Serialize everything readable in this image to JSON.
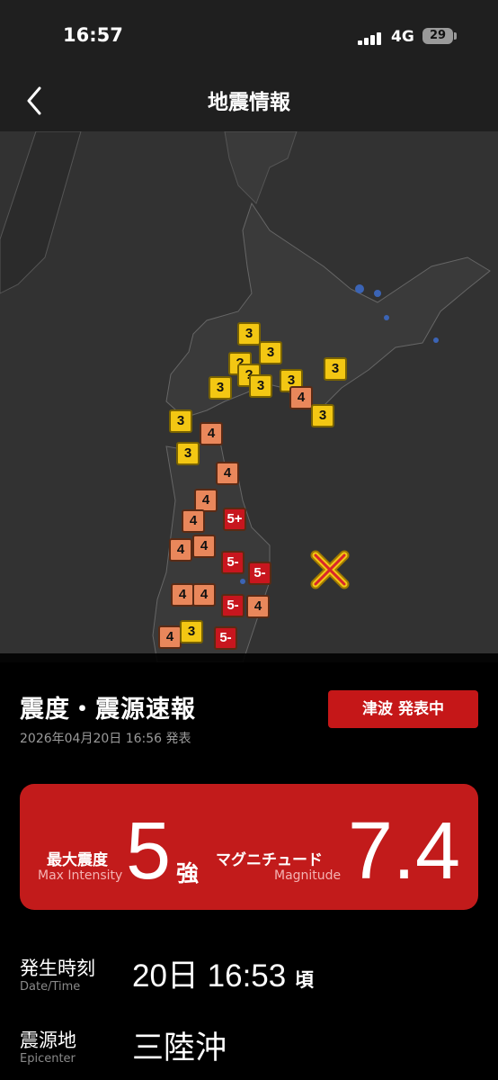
{
  "status_bar": {
    "time": "16:57",
    "network": "4G",
    "battery": "29"
  },
  "nav": {
    "title": "地震情報"
  },
  "map": {
    "markers": [
      {
        "label": "3",
        "level": "3"
      },
      {
        "label": "3",
        "level": "3"
      },
      {
        "label": "?",
        "level": "3"
      },
      {
        "label": "?",
        "level": "3"
      },
      {
        "label": "3",
        "level": "3"
      },
      {
        "label": "3",
        "level": "3"
      },
      {
        "label": "3",
        "level": "3"
      },
      {
        "label": "3",
        "level": "3"
      },
      {
        "label": "4",
        "level": "4"
      },
      {
        "label": "3",
        "level": "3"
      },
      {
        "label": "3",
        "level": "3"
      },
      {
        "label": "4",
        "level": "4"
      },
      {
        "label": "3",
        "level": "3"
      },
      {
        "label": "4",
        "level": "4"
      },
      {
        "label": "4",
        "level": "4"
      },
      {
        "label": "4",
        "level": "4"
      },
      {
        "label": "5+",
        "level": "5"
      },
      {
        "label": "4",
        "level": "4"
      },
      {
        "label": "4",
        "level": "4"
      },
      {
        "label": "5-",
        "level": "5"
      },
      {
        "label": "5-",
        "level": "5"
      },
      {
        "label": "4",
        "level": "4"
      },
      {
        "label": "4",
        "level": "4"
      },
      {
        "label": "5-",
        "level": "5"
      },
      {
        "label": "4",
        "level": "4"
      },
      {
        "label": "4",
        "level": "4"
      },
      {
        "label": "3",
        "level": "3"
      },
      {
        "label": "5-",
        "level": "5"
      }
    ],
    "colors": {
      "level3": "#f3c713",
      "level4": "#e9875b",
      "level5": "#c8161e",
      "epicenter": "#f3c713",
      "water": "#3b64b5"
    }
  },
  "report": {
    "title": "震度・震源速報",
    "published": "2026年04月20日 16:56 発表",
    "tsunami_badge": "津波 発表中",
    "max_intensity": {
      "label_jp": "最大震度",
      "label_en": "Max Intensity",
      "value": "5",
      "suffix": "強"
    },
    "magnitude": {
      "label_jp": "マグニチュード",
      "label_en": "Magnitude",
      "value": "7.4"
    },
    "datetime": {
      "label_jp": "発生時刻",
      "label_en": "Date/Time",
      "value": "20日 16:53",
      "suffix": "頃"
    },
    "epicenter": {
      "label_jp": "震源地",
      "label_en": "Epicenter",
      "value": "三陸沖"
    }
  }
}
